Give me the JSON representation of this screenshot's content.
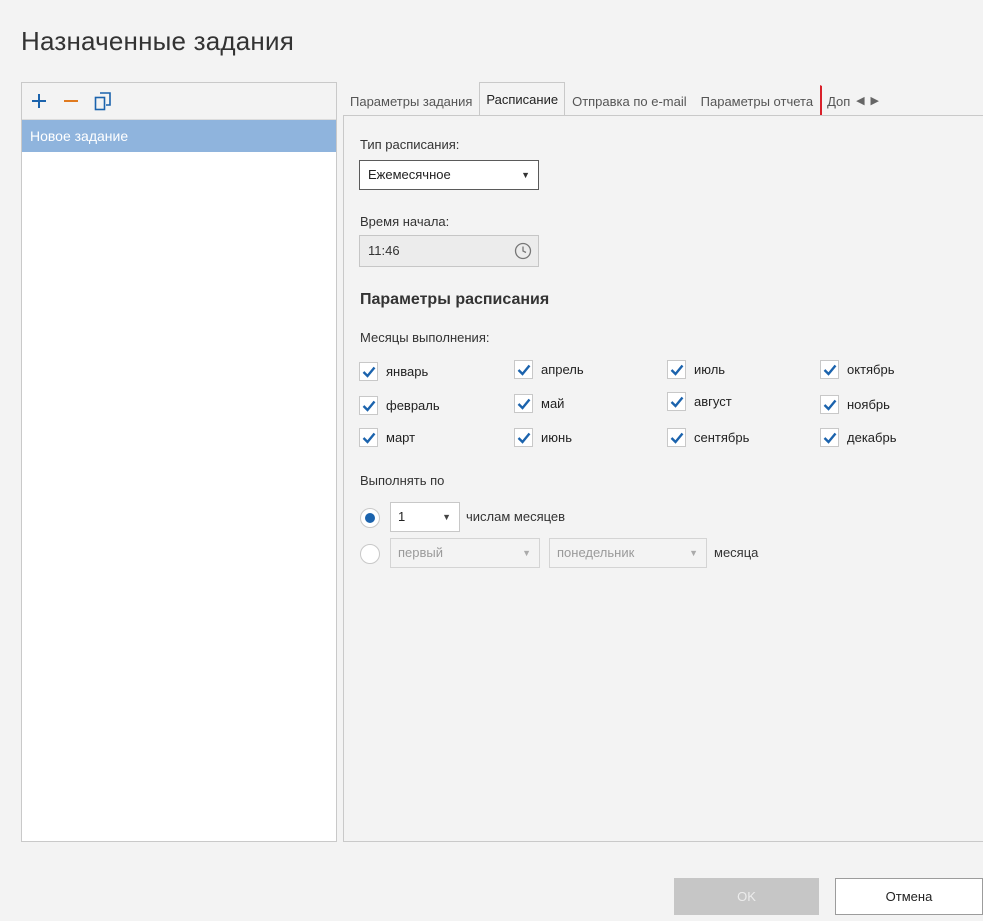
{
  "window": {
    "title": "Назначенные задания"
  },
  "toolbar": {
    "add_icon": "plus-icon",
    "remove_icon": "minus-icon",
    "copy_icon": "copy-icon",
    "colors": {
      "add": "#1b63ad",
      "remove": "#e07a1f"
    }
  },
  "task_list": {
    "items": [
      {
        "label": "Новое задание",
        "selected": true
      }
    ]
  },
  "tabs": [
    {
      "label": "Параметры задания",
      "active": false
    },
    {
      "label": "Расписание",
      "active": true
    },
    {
      "label": "Отправка по e-mail",
      "active": false
    },
    {
      "label": "Параметры отчета",
      "active": false
    },
    {
      "label": "Доп",
      "active": false
    }
  ],
  "schedule": {
    "type_label": "Тип расписания:",
    "type_value": "Ежемесячное",
    "start_time_label": "Время начала:",
    "start_time_value": "11:46",
    "params_heading": "Параметры расписания",
    "months_label": "Месяцы выполнения:",
    "months": [
      {
        "label": "январь",
        "checked": true
      },
      {
        "label": "февраль",
        "checked": true
      },
      {
        "label": "март",
        "checked": true
      },
      {
        "label": "апрель",
        "checked": true
      },
      {
        "label": "май",
        "checked": true
      },
      {
        "label": "июнь",
        "checked": true
      },
      {
        "label": "июль",
        "checked": true
      },
      {
        "label": "август",
        "checked": true
      },
      {
        "label": "сентябрь",
        "checked": true
      },
      {
        "label": "октябрь",
        "checked": true
      },
      {
        "label": "ноябрь",
        "checked": true
      },
      {
        "label": "декабрь",
        "checked": true
      }
    ],
    "run_by_label": "Выполнять по",
    "option_day": {
      "selected": true,
      "day_value": "1",
      "suffix": "числам месяцев"
    },
    "option_weekday": {
      "selected": false,
      "ordinal_value": "первый",
      "weekday_value": "понедельник",
      "suffix": "месяца"
    }
  },
  "buttons": {
    "ok_label": "OK",
    "cancel_label": "Отмена"
  },
  "colors": {
    "accent": "#1b63ad",
    "selection": "#8fb4dd",
    "tab_marker": "#d9202a"
  }
}
